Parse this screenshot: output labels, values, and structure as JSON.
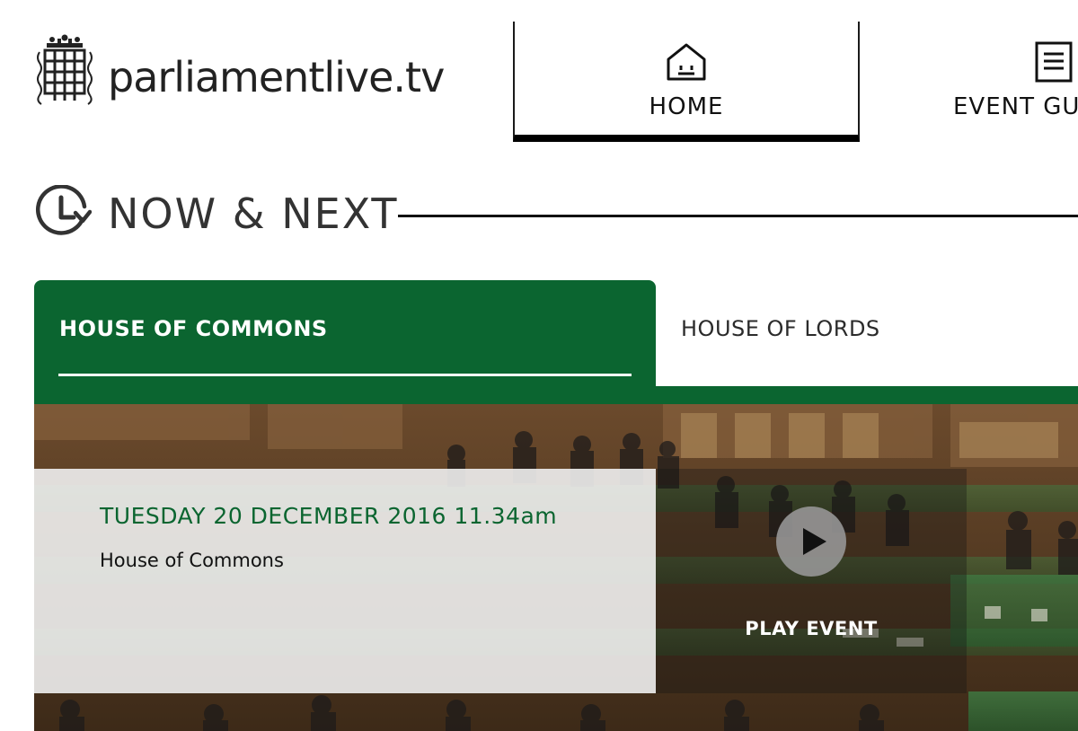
{
  "brand": {
    "name": "parliamentlive.tv"
  },
  "nav": {
    "items": [
      {
        "label": "HOME",
        "icon": "home-icon",
        "active": true
      },
      {
        "label": "EVENT GUI",
        "icon": "document-list-icon",
        "active": false
      }
    ]
  },
  "section": {
    "title": "NOW & NEXT",
    "icon": "clock-refresh-icon"
  },
  "tabs": [
    {
      "label": "HOUSE OF COMMONS",
      "active": true
    },
    {
      "label": "HOUSE OF LORDS",
      "active": false
    }
  ],
  "event": {
    "date": "TUESDAY 20 DECEMBER 2016 11.34am",
    "house": "House of Commons",
    "play_label": "PLAY EVENT"
  },
  "colors": {
    "commons_green": "#0b6530",
    "text_dark": "#222222"
  }
}
